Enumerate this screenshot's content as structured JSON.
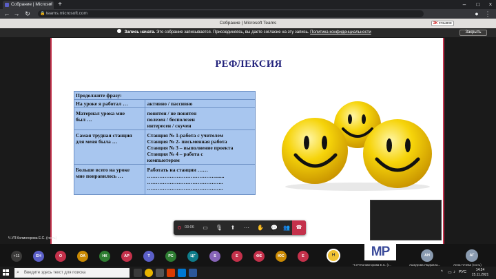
{
  "browser": {
    "tab_title": "Собрание | Microsof",
    "url": "teams.microsoft.com",
    "new_tab": "+"
  },
  "teams": {
    "window_title": "Собрание | Microsoft Teams",
    "extension_badge_count": "2K",
    "extension_badge_text": "отзывов"
  },
  "banner": {
    "title": "Запись начата.",
    "message": "Это собрание записывается. Присоединяясь, вы даете согласие на эту запись.",
    "privacy_link": "Политика конфиденциальности",
    "close_label": "Закрыть"
  },
  "slide": {
    "title": "РЕФЛЕКСИЯ",
    "table": {
      "header": "Продолжите фразу:",
      "rows": [
        {
          "left": [
            "На уроке я работал …"
          ],
          "right": [
            "активно / пассивно"
          ]
        },
        {
          "left": [
            "Материал урока мне",
            "был …"
          ],
          "right": [
            "понятен / не понятен",
            "полезен / бесполезен",
            "интересен / скучен"
          ]
        },
        {
          "left": [
            "Самая трудная станция",
            "для меня была …"
          ],
          "right": [
            "Станция № 1-работа с учителем",
            "Станция № 2- письменная работа",
            "Станция № 3 – выполнение проекта",
            "Станция № 4 – работа с",
            "компьютером"
          ]
        },
        {
          "left": [
            "Больше всего на уроке",
            "мне понравилось …"
          ],
          "right": [
            "Работать на станции ……",
            "………………………………….......",
            "……………………………………..",
            "…………………………………….."
          ]
        }
      ]
    }
  },
  "presenter_caption": "Ч.УЛ Колмогорова Е.С. (гость)",
  "controls": {
    "timer": "03:06"
  },
  "participants": {
    "more": "+11",
    "avatars": [
      {
        "initials": "ЕН",
        "color": "#5b5fc7"
      },
      {
        "initials": "О",
        "color": "#c4314b"
      },
      {
        "initials": "ОА",
        "color": "#ca8a04"
      },
      {
        "initials": "НК",
        "color": "#2e7d32"
      },
      {
        "initials": "АР",
        "color": "#c4314b"
      },
      {
        "initials": "Т",
        "color": "#5b5fc7"
      },
      {
        "initials": "РС",
        "color": "#2e7d32"
      },
      {
        "initials": "ЦГ",
        "color": "#0f7c8a"
      },
      {
        "initials": "S",
        "color": "#8764b8"
      },
      {
        "initials": "Е",
        "color": "#c4314b"
      },
      {
        "initials": "ФЕ",
        "color": "#c4314b"
      },
      {
        "initials": "ЮС",
        "color": "#ca8a04"
      },
      {
        "initials": "Е",
        "color": "#c4314b"
      }
    ],
    "h_initial": "Н",
    "mp_label": "MP",
    "mp_caption": "Ч.УЛ Колмогорова Е.С. (г...",
    "right_tiles": [
      {
        "initials": "АН",
        "color": "#8a9bb0",
        "name": "Ашкурова Людмила..."
      },
      {
        "initials": "АГ",
        "color": "#8a9bb0",
        "name": "Анна Гочева (гость)"
      }
    ]
  },
  "taskbar": {
    "search_placeholder": "Введите здесь текст для поиска",
    "language": "РУС",
    "time": "14:24",
    "date": "15.11.2021"
  }
}
